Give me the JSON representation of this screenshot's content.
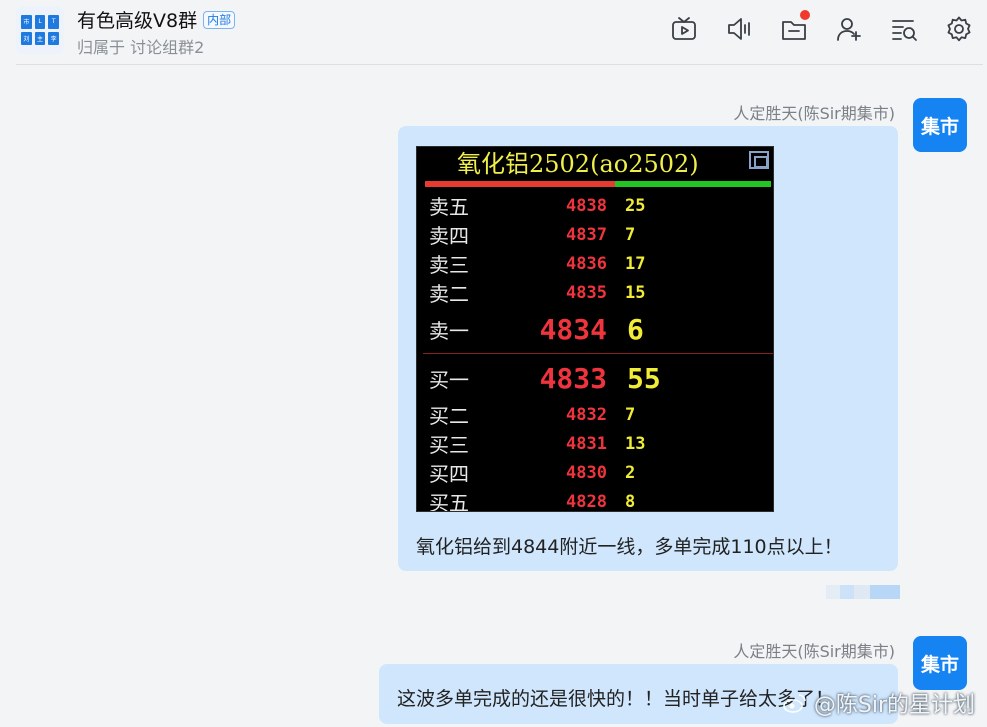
{
  "header": {
    "group_name": "有色高级V8群",
    "tag": "内部",
    "subtitle": "归属于 讨论组群2",
    "avatar_cells": [
      "市",
      "L",
      "T",
      "刘",
      "主",
      "李"
    ],
    "icons": [
      "tv-icon",
      "speaker-icon",
      "folder-icon",
      "add-user-icon",
      "search-list-icon",
      "gear-icon"
    ]
  },
  "messages": [
    {
      "sender": "人定胜天(陈Sir期集市)",
      "avatar_text": "集市",
      "text": "氧化铝给到4844附近一线，多单完成110点以上！",
      "orderbook": {
        "title": "氧化铝2502(ao2502)",
        "asks": [
          {
            "label": "卖五",
            "price": "4838",
            "vol": "25"
          },
          {
            "label": "卖四",
            "price": "4837",
            "vol": "7"
          },
          {
            "label": "卖三",
            "price": "4836",
            "vol": "17"
          },
          {
            "label": "卖二",
            "price": "4835",
            "vol": "15"
          },
          {
            "label": "卖一",
            "price": "4834",
            "vol": "6"
          }
        ],
        "bids": [
          {
            "label": "买一",
            "price": "4833",
            "vol": "55"
          },
          {
            "label": "买二",
            "price": "4832",
            "vol": "7"
          },
          {
            "label": "买三",
            "price": "4831",
            "vol": "13"
          },
          {
            "label": "买四",
            "price": "4830",
            "vol": "2"
          },
          {
            "label": "买五",
            "price": "4828",
            "vol": "8"
          }
        ]
      }
    },
    {
      "sender": "人定胜天(陈Sir期集市)",
      "avatar_text": "集市",
      "text": "这波多单完成的还是很快的！！当时单子给太多了！"
    }
  ],
  "watermark": "@陈Sir的星计划",
  "colors": {
    "bubble": "#cfe6fd",
    "avatar": "#1683f2",
    "badge": "#f03a2e"
  }
}
